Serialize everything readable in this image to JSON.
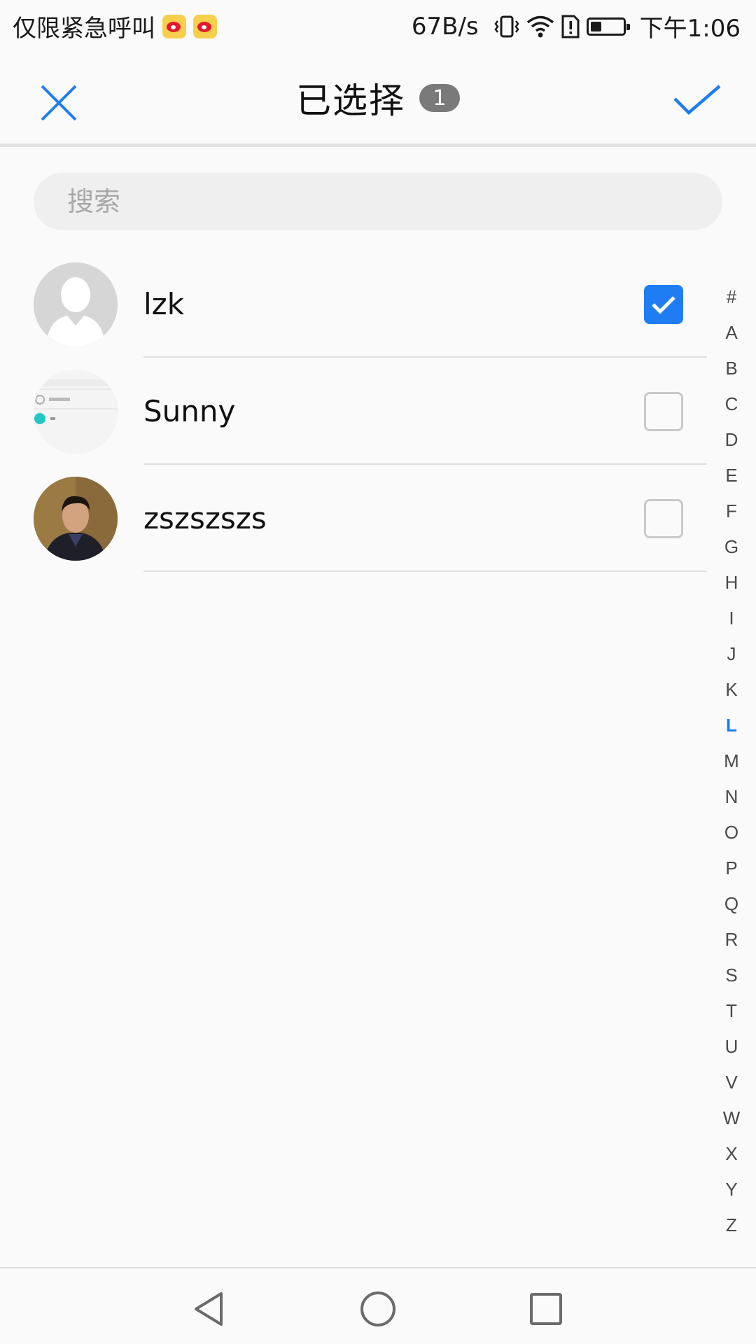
{
  "status_bar": {
    "carrier_text": "仅限紧急呼叫",
    "notification_icons": [
      "weibo-icon",
      "weibo-icon"
    ],
    "net_speed": "67B/s",
    "time": "下午1:06",
    "battery_level": 0.35
  },
  "header": {
    "title": "已选择",
    "selected_count": "1"
  },
  "search": {
    "placeholder": "搜索"
  },
  "contacts": [
    {
      "name": "lzk",
      "checked": true,
      "avatar": "default-avatar"
    },
    {
      "name": "Sunny",
      "checked": false,
      "avatar": "screenshot-avatar"
    },
    {
      "name": "zszszszs",
      "checked": false,
      "avatar": "photo-avatar"
    }
  ],
  "alphabet_index": {
    "letters": [
      "#",
      "A",
      "B",
      "C",
      "D",
      "E",
      "F",
      "G",
      "H",
      "I",
      "J",
      "K",
      "L",
      "M",
      "N",
      "O",
      "P",
      "Q",
      "R",
      "S",
      "T",
      "U",
      "V",
      "W",
      "X",
      "Y",
      "Z"
    ],
    "active": "L"
  },
  "colors": {
    "accent": "#1e7df2",
    "badge": "#7a7a7a",
    "background": "#fafafa",
    "divider": "#dedede"
  }
}
